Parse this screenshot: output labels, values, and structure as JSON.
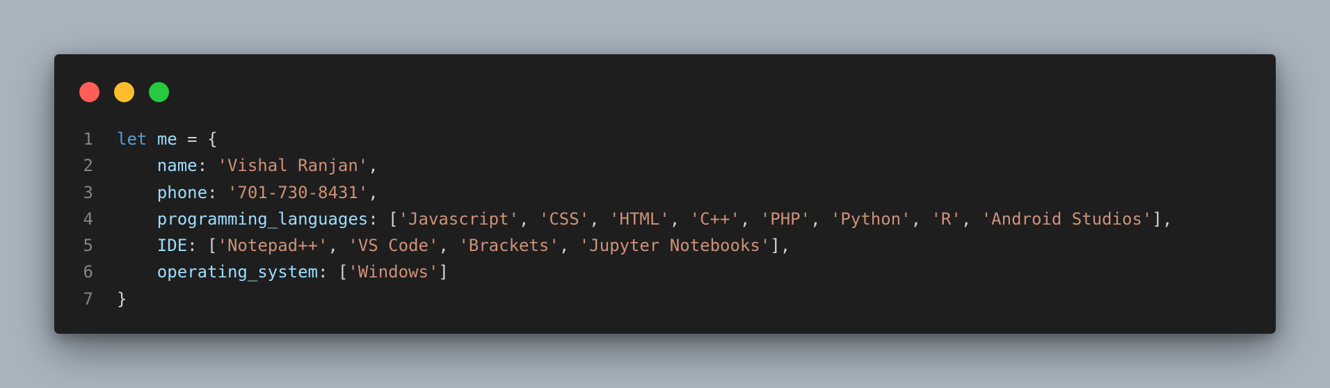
{
  "colors": {
    "page_background": "#a9b4bf",
    "editor_background": "#1e1e1e",
    "dot_close": "#ff5f56",
    "dot_minimize": "#ffbd2e",
    "dot_maximize": "#27c93f",
    "keyword": "#569cd6",
    "property": "#9cdcfe",
    "string": "#ce9178",
    "punctuation": "#d4d4d4",
    "line_number": "#858585"
  },
  "window_controls": [
    "close",
    "minimize",
    "maximize"
  ],
  "code": {
    "line_numbers": [
      "1",
      "2",
      "3",
      "4",
      "5",
      "6",
      "7"
    ],
    "lines": [
      [
        {
          "t": "kw",
          "v": "let"
        },
        {
          "t": "pun",
          "v": " "
        },
        {
          "t": "var",
          "v": "me"
        },
        {
          "t": "pun",
          "v": " = {"
        }
      ],
      [
        {
          "t": "pun",
          "v": "    "
        },
        {
          "t": "prop",
          "v": "name"
        },
        {
          "t": "pun",
          "v": ": "
        },
        {
          "t": "str",
          "v": "'Vishal Ranjan'"
        },
        {
          "t": "pun",
          "v": ","
        }
      ],
      [
        {
          "t": "pun",
          "v": "    "
        },
        {
          "t": "prop",
          "v": "phone"
        },
        {
          "t": "pun",
          "v": ": "
        },
        {
          "t": "str",
          "v": "'701-730-8431'"
        },
        {
          "t": "pun",
          "v": ","
        }
      ],
      [
        {
          "t": "pun",
          "v": "    "
        },
        {
          "t": "prop",
          "v": "programming_languages"
        },
        {
          "t": "pun",
          "v": ": ["
        },
        {
          "t": "str",
          "v": "'Javascript'"
        },
        {
          "t": "pun",
          "v": ", "
        },
        {
          "t": "str",
          "v": "'CSS'"
        },
        {
          "t": "pun",
          "v": ", "
        },
        {
          "t": "str",
          "v": "'HTML'"
        },
        {
          "t": "pun",
          "v": ", "
        },
        {
          "t": "str",
          "v": "'C++'"
        },
        {
          "t": "pun",
          "v": ", "
        },
        {
          "t": "str",
          "v": "'PHP'"
        },
        {
          "t": "pun",
          "v": ", "
        },
        {
          "t": "str",
          "v": "'Python'"
        },
        {
          "t": "pun",
          "v": ", "
        },
        {
          "t": "str",
          "v": "'R'"
        },
        {
          "t": "pun",
          "v": ", "
        },
        {
          "t": "str",
          "v": "'Android Studios'"
        },
        {
          "t": "pun",
          "v": "],"
        }
      ],
      [
        {
          "t": "pun",
          "v": "    "
        },
        {
          "t": "prop",
          "v": "IDE"
        },
        {
          "t": "pun",
          "v": ": ["
        },
        {
          "t": "str",
          "v": "'Notepad++'"
        },
        {
          "t": "pun",
          "v": ", "
        },
        {
          "t": "str",
          "v": "'VS Code'"
        },
        {
          "t": "pun",
          "v": ", "
        },
        {
          "t": "str",
          "v": "'Brackets'"
        },
        {
          "t": "pun",
          "v": ", "
        },
        {
          "t": "str",
          "v": "'Jupyter Notebooks'"
        },
        {
          "t": "pun",
          "v": "],"
        }
      ],
      [
        {
          "t": "pun",
          "v": "    "
        },
        {
          "t": "prop",
          "v": "operating_system"
        },
        {
          "t": "pun",
          "v": ": ["
        },
        {
          "t": "str",
          "v": "'Windows'"
        },
        {
          "t": "pun",
          "v": "]"
        }
      ],
      [
        {
          "t": "pun",
          "v": "}"
        }
      ]
    ]
  }
}
